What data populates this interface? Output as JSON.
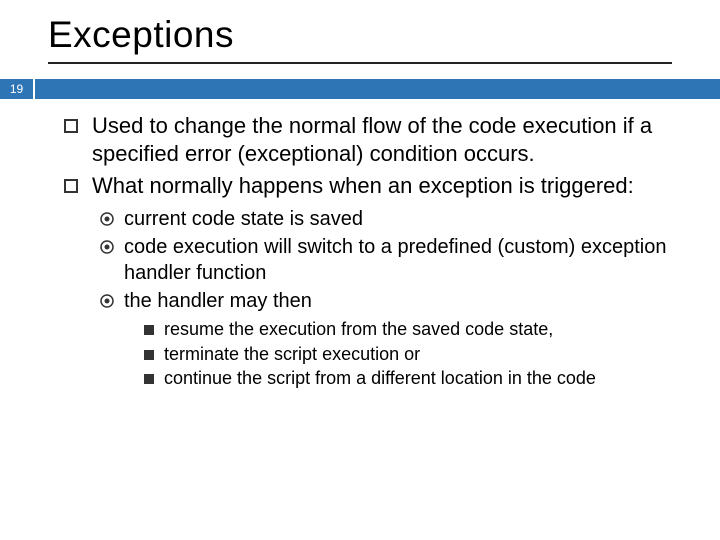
{
  "title": "Exceptions",
  "page_number": "19",
  "bullets": {
    "b1": "Used to change the normal flow of the code execution if a specified error (exceptional) condition occurs.",
    "b2": "What normally happens when an exception is triggered:",
    "b2_1": "current code state is saved",
    "b2_2": "code execution will switch to a predefined (custom) exception handler function",
    "b2_3": "the handler may then",
    "b2_3_1": "resume the execution from the saved code state,",
    "b2_3_2": "terminate the script execution or",
    "b2_3_3": "continue the script from a different location in the code"
  }
}
